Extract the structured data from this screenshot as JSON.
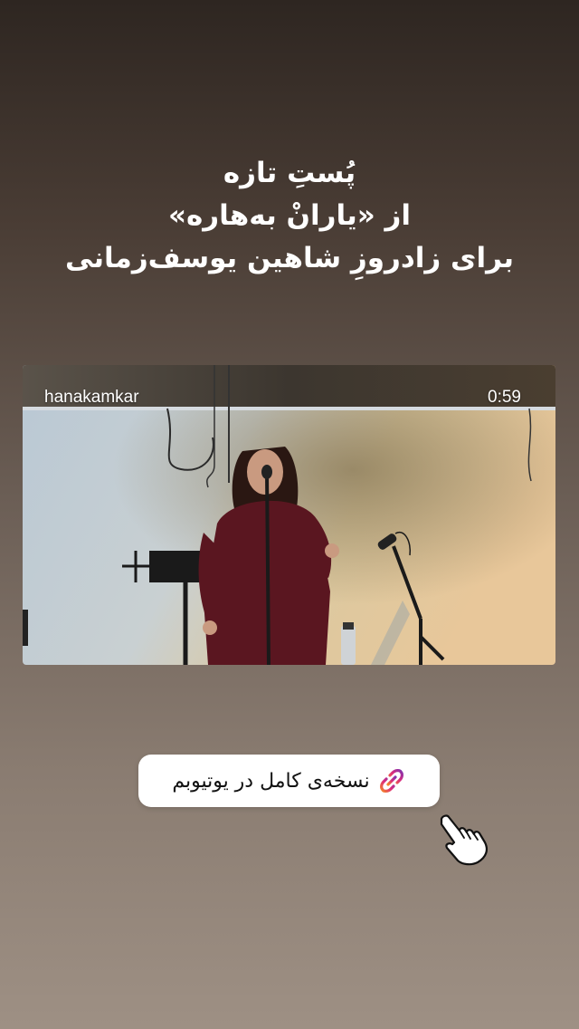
{
  "story": {
    "headline": {
      "line1": "پُستِ تازه",
      "line2": "از «یارانْ بەهارە»",
      "line3": "برای زادروزِ شاهین یوسف‌زمانی"
    },
    "video": {
      "username": "hanakamkar",
      "duration": "0:59"
    },
    "link_sticker": {
      "label": "نسخه‌ی کامل در یوتیوبم",
      "icon": "link-icon"
    },
    "pointer_icon": "hand-pointer-icon",
    "colors": {
      "background_top": "#2e2621",
      "background_bottom": "#9e9084",
      "sticker_bg": "#ffffff",
      "link_gradient_start": "#f58529",
      "link_gradient_end": "#8134af"
    }
  }
}
